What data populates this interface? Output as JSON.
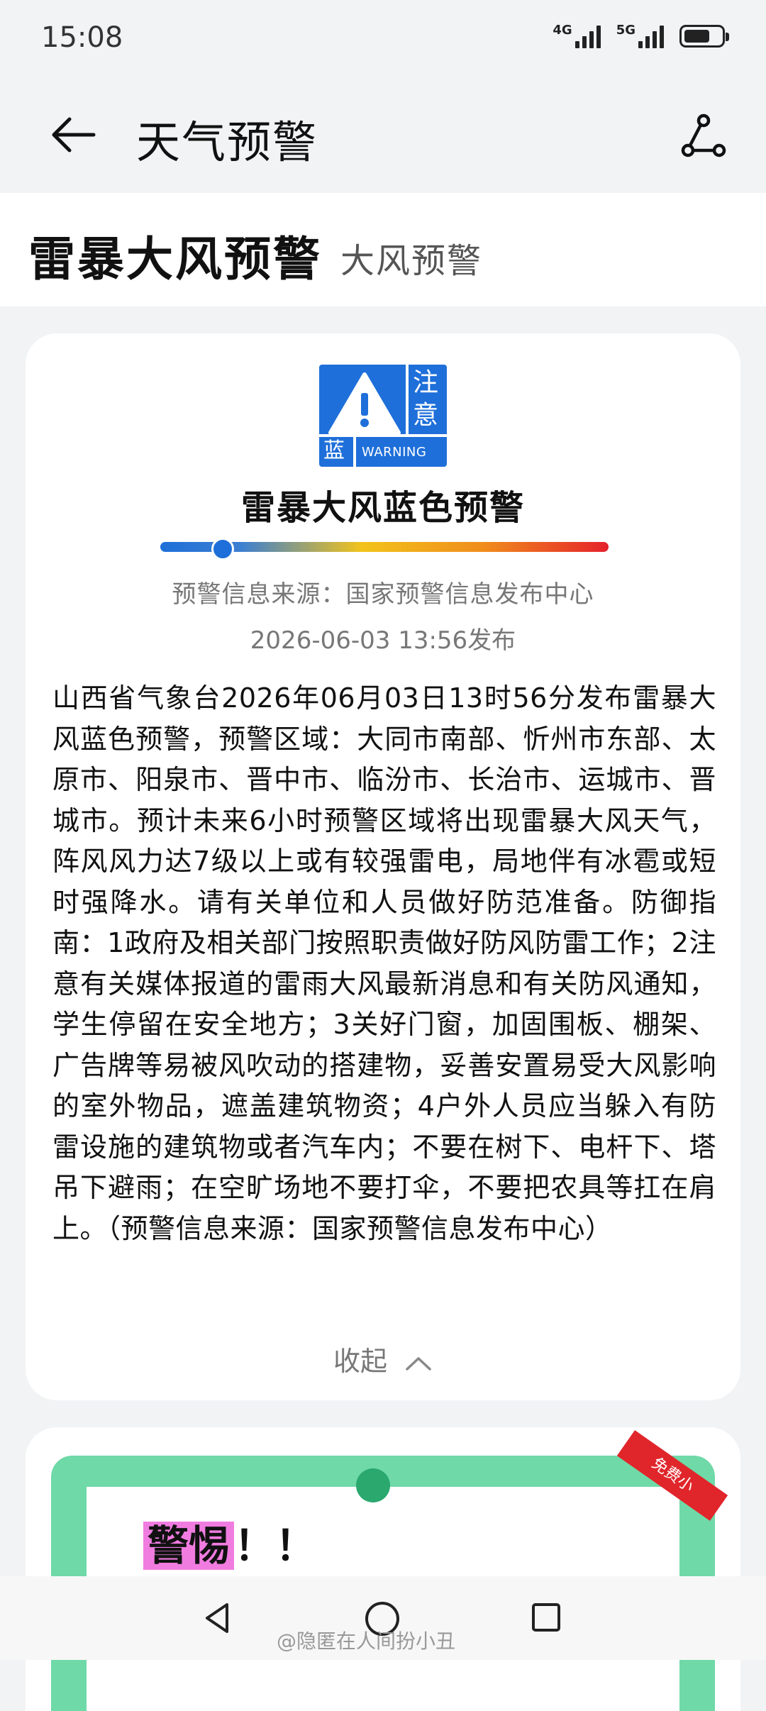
{
  "status_bar": {
    "time": "15:08",
    "network1": "4G",
    "network2": "5G",
    "battery_level": 0.7
  },
  "app_bar": {
    "back_icon": "arrow-left-icon",
    "title": "天气预警",
    "share_icon": "share-icon"
  },
  "heading": {
    "title": "雷暴大风预警",
    "subtitle": "大风预警"
  },
  "warning_card": {
    "badge": {
      "char_top": "注",
      "char_bottom": "意",
      "color_label": "蓝",
      "english": "WARNING",
      "color": "#1e6fd9"
    },
    "title": "雷暴大风蓝色预警",
    "level_fraction": 0.14,
    "source": "预警信息来源：国家预警信息发布中心",
    "published": "2026-06-03 13:56发布",
    "body": "山西省气象台2026年06月03日13时56分发布雷暴大风蓝色预警，预警区域：大同市南部、忻州市东部、太原市、阳泉市、晋中市、临汾市、长治市、运城市、晋城市。预计未来6小时预警区域将出现雷暴大风天气，阵风风力达7级以上或有较强雷电，局地伴有冰雹或短时强降水。请有关单位和人员做好防范准备。防御指南：1政府及相关部门按照职责做好防风防雷工作；2注意有关媒体报道的雷雨大风最新消息和有关防风通知，学生停留在安全地方；3关好门窗，加固围板、棚架、广告牌等易被风吹动的搭建物，妥善安置易受大风影响的室外物品，遮盖建筑物资；4户外人员应当躲入有防雷设施的建筑物或者汽车内；不要在树下、电杆下、塔吊下避雨；在空旷场地不要打伞，不要把农具等扛在肩上。（预警信息来源：国家预警信息发布中心）",
    "collapse_label": "收起"
  },
  "promo_card": {
    "alert_text_highlight": "警惕",
    "alert_text_rest": "！！",
    "ribbon": "免费小"
  },
  "nav_bar": {
    "watermark": "@隐匿在人间扮小丑"
  }
}
